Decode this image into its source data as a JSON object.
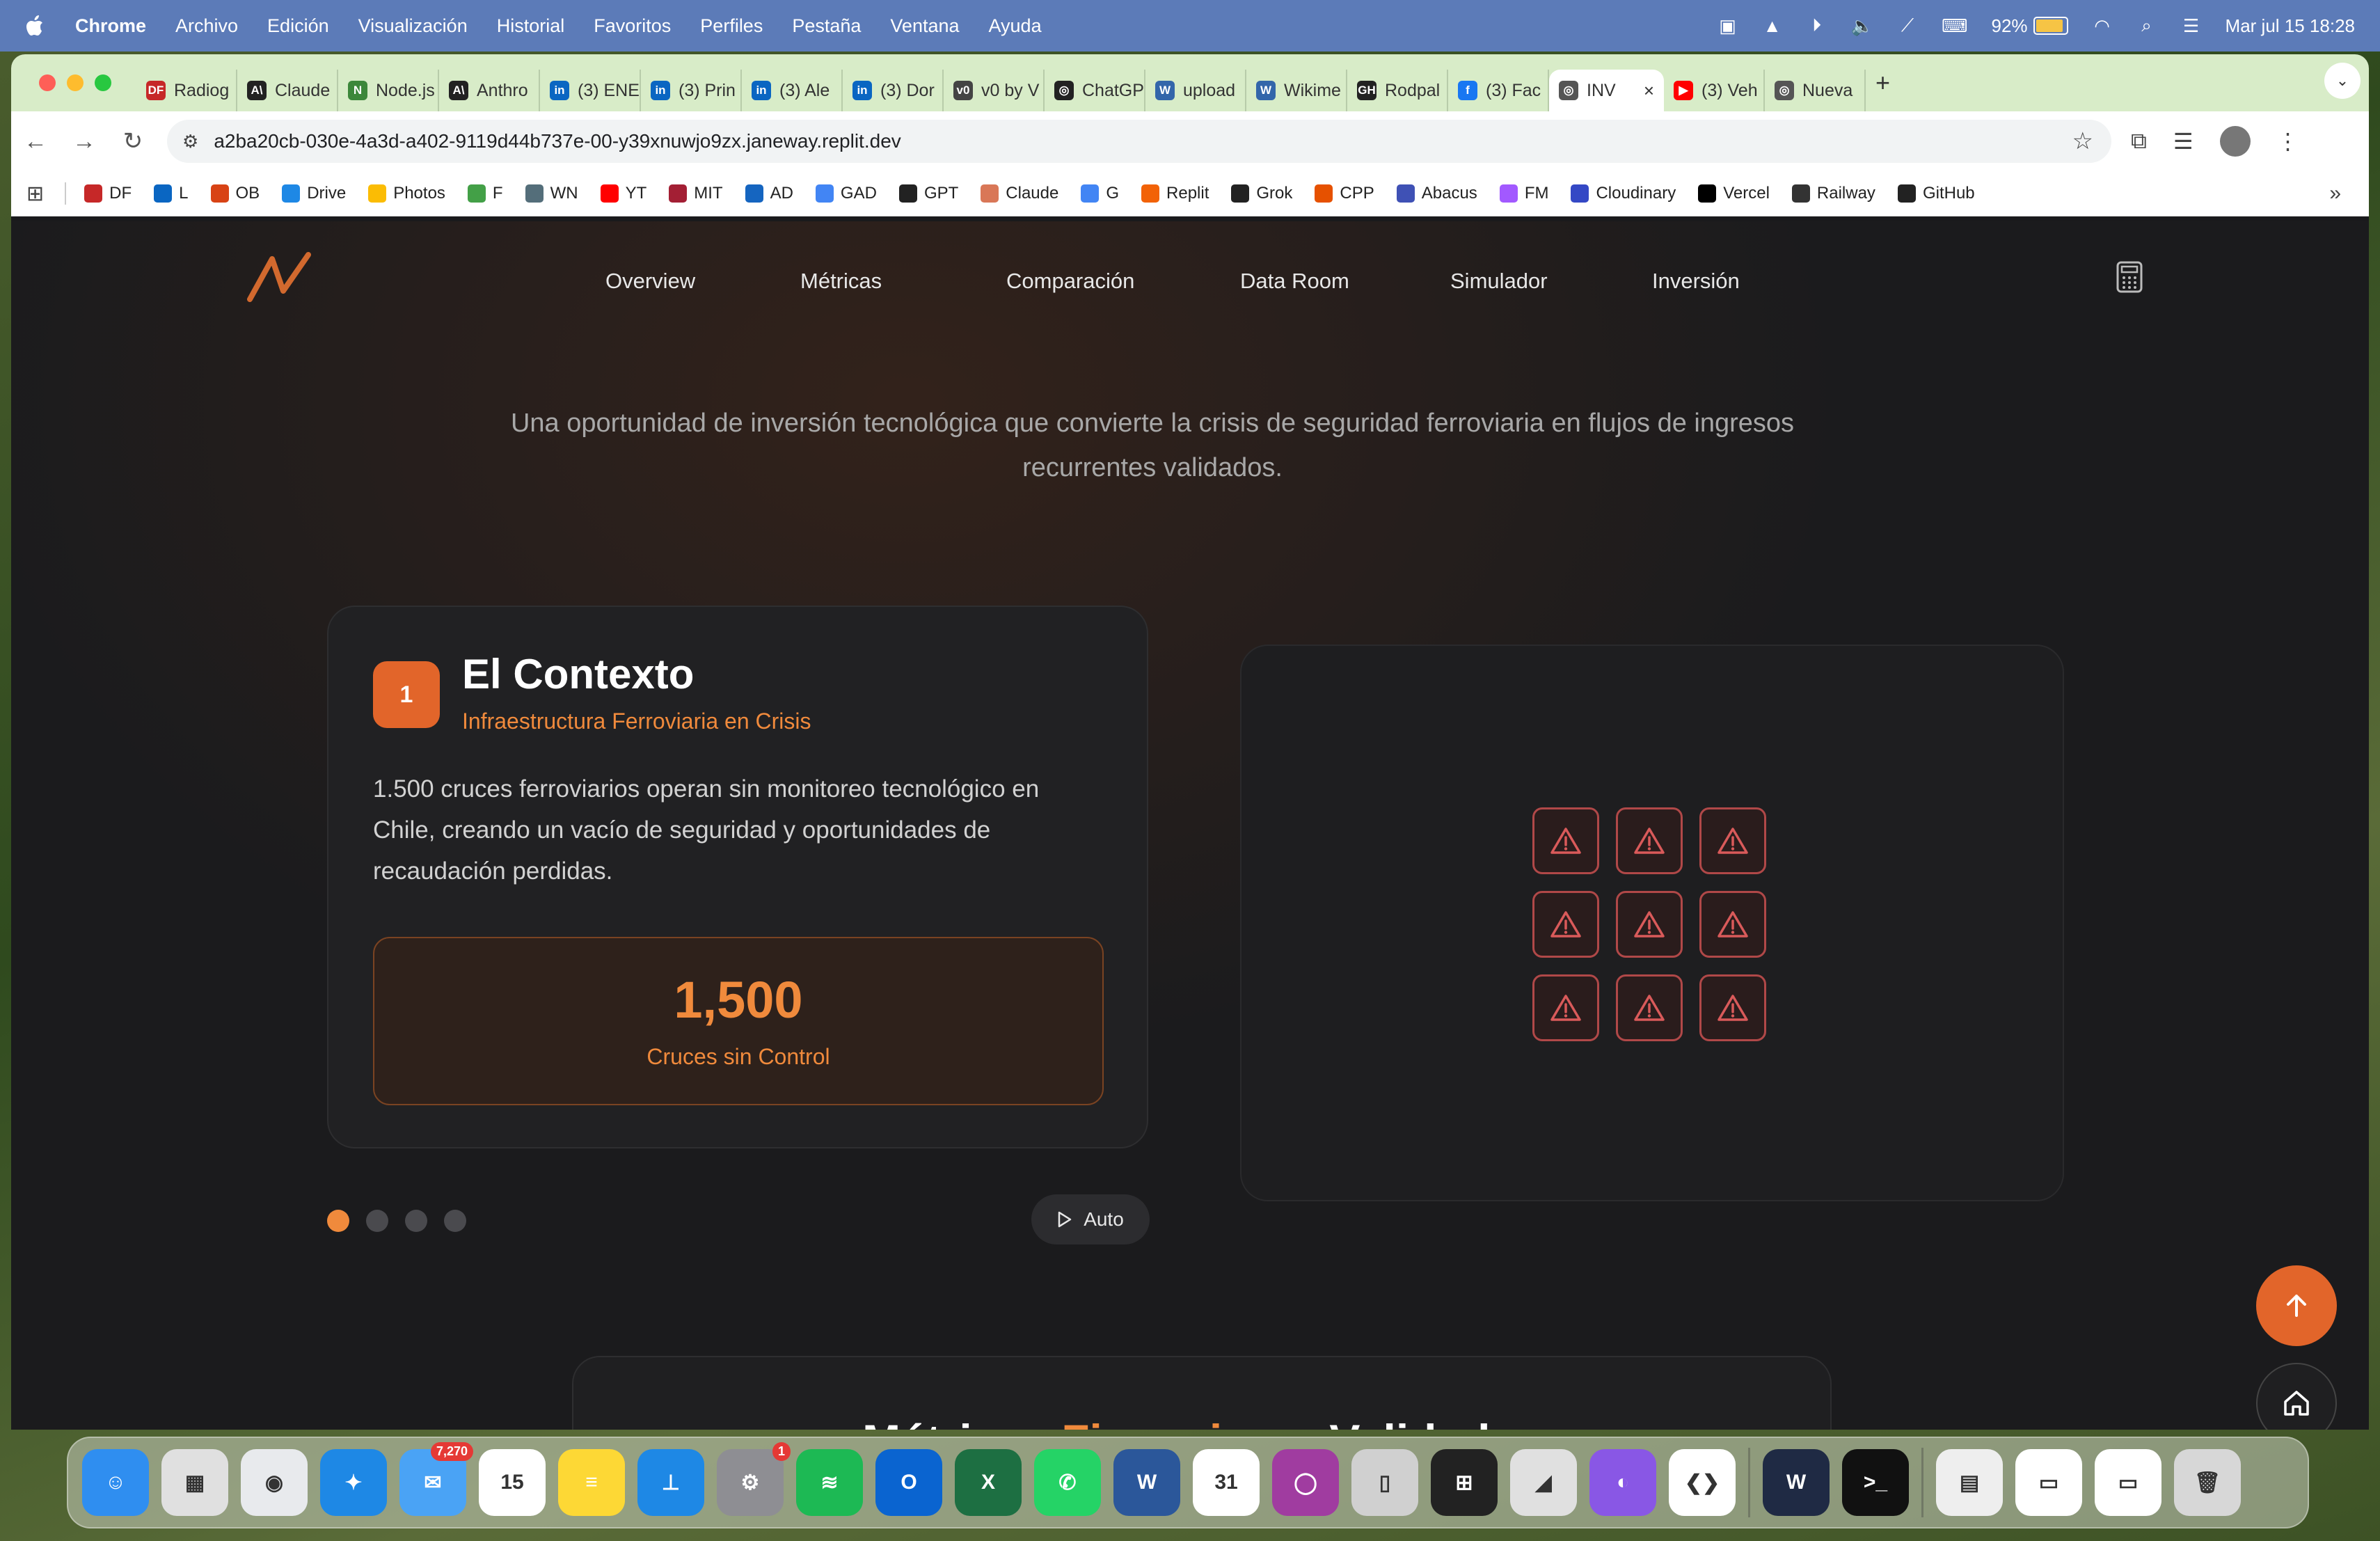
{
  "menubar": {
    "app_name": "Chrome",
    "menus": [
      "Archivo",
      "Edición",
      "Visualización",
      "Historial",
      "Favoritos",
      "Perfiles",
      "Pestaña",
      "Ventana",
      "Ayuda"
    ],
    "battery_percent": "92%",
    "battery_level": 0.92,
    "datetime": "Mar jul 15  18:28"
  },
  "tabs": [
    {
      "title": "Radiog",
      "favicon": "DF",
      "color": "#c62828"
    },
    {
      "title": "Claude",
      "favicon": "A\\",
      "color": "#222222"
    },
    {
      "title": "Node.js",
      "favicon": "N",
      "color": "#3c873a"
    },
    {
      "title": "Anthro",
      "favicon": "A\\",
      "color": "#222222"
    },
    {
      "title": "(3) ENE",
      "favicon": "in",
      "color": "#0a66c2"
    },
    {
      "title": "(3) Prin",
      "favicon": "in",
      "color": "#0a66c2"
    },
    {
      "title": "(3) Ale",
      "favicon": "in",
      "color": "#0a66c2"
    },
    {
      "title": "(3) Dor",
      "favicon": "in",
      "color": "#0a66c2"
    },
    {
      "title": "v0 by V",
      "favicon": "v0",
      "color": "#444444"
    },
    {
      "title": "ChatGP",
      "favicon": "◎",
      "color": "#222222"
    },
    {
      "title": "upload",
      "favicon": "W",
      "color": "#3366aa"
    },
    {
      "title": "Wikime",
      "favicon": "W",
      "color": "#3366aa"
    },
    {
      "title": "Rodpal",
      "favicon": "GH",
      "color": "#222222"
    },
    {
      "title": "(3) Fac",
      "favicon": "f",
      "color": "#1877f2"
    },
    {
      "title": "INV",
      "favicon": "◎",
      "color": "#555555",
      "active": true
    },
    {
      "title": "(3) Veh",
      "favicon": "▶",
      "color": "#ff0000"
    },
    {
      "title": "Nueva",
      "favicon": "◎",
      "color": "#555555"
    }
  ],
  "omnibox": {
    "url": "a2ba20cb-030e-4a3d-a402-9119d44b737e-00-y39xnuwjo9zx.janeway.replit.dev"
  },
  "bookmarks": [
    {
      "label": "DF",
      "color": "#c62828"
    },
    {
      "label": "L",
      "color": "#0a66c2"
    },
    {
      "label": "OB",
      "color": "#d84315"
    },
    {
      "label": "Drive",
      "color": "#1e88e5"
    },
    {
      "label": "Photos",
      "color": "#fbbc04"
    },
    {
      "label": "F",
      "color": "#43a047"
    },
    {
      "label": "WN",
      "color": "#546e7a"
    },
    {
      "label": "YT",
      "color": "#ff0000"
    },
    {
      "label": "MIT",
      "color": "#a31f34"
    },
    {
      "label": "AD",
      "color": "#1565c0"
    },
    {
      "label": "GAD",
      "color": "#4285f4"
    },
    {
      "label": "GPT",
      "color": "#222222"
    },
    {
      "label": "Claude",
      "color": "#d97757"
    },
    {
      "label": "G",
      "color": "#4285f4"
    },
    {
      "label": "Replit",
      "color": "#f26207"
    },
    {
      "label": "Grok",
      "color": "#222222"
    },
    {
      "label": "CPP",
      "color": "#e65100"
    },
    {
      "label": "Abacus",
      "color": "#3f51b5"
    },
    {
      "label": "FM",
      "color": "#a259ff"
    },
    {
      "label": "Cloudinary",
      "color": "#3448c5"
    },
    {
      "label": "Vercel",
      "color": "#000000"
    },
    {
      "label": "Railway",
      "color": "#333333"
    },
    {
      "label": "GitHub",
      "color": "#222222"
    }
  ],
  "site": {
    "nav": [
      "Overview",
      "Métricas",
      "Comparación",
      "Data Room",
      "Simulador",
      "Inversión"
    ],
    "subtitle": "Una oportunidad de inversión tecnológica que convierte la crisis de seguridad ferroviaria en flujos de ingresos recurrentes validados.",
    "accent_color": "#f08a3c",
    "step": {
      "number": "1",
      "title": "El Contexto",
      "subtitle": "Infraestructura Ferroviaria en Crisis",
      "body": "1.500 cruces ferroviarios operan sin monitoreo tecnológico en Chile, creando un vacío de seguridad y oportunidades de recaudación perdidas.",
      "stat_value": "1,500",
      "stat_label": "Cruces sin Control"
    },
    "warning_icons": 9,
    "carousel": {
      "total": 4,
      "active": 1,
      "auto_label": "Auto"
    },
    "metrics_heading": {
      "part1": "Métricas ",
      "accent": "Financieras",
      "part2": " Validadas"
    }
  },
  "dock": {
    "apps": [
      {
        "name": "finder-icon",
        "color": "#2f8ef0",
        "glyph": "☺"
      },
      {
        "name": "launchpad-icon",
        "color": "#e0e0e0",
        "glyph": "▦"
      },
      {
        "name": "chrome-icon",
        "color": "#e8eaed",
        "glyph": "◉"
      },
      {
        "name": "safari-icon",
        "color": "#1e88e5",
        "glyph": "✦"
      },
      {
        "name": "mail-icon",
        "color": "#4aa3f5",
        "glyph": "✉",
        "badge": "7,270"
      },
      {
        "name": "calendar-icon",
        "color": "#ffffff",
        "glyph": "15"
      },
      {
        "name": "notes-icon",
        "color": "#fdd835",
        "glyph": "≡"
      },
      {
        "name": "keynote-icon",
        "color": "#1e88e5",
        "glyph": "⊥"
      },
      {
        "name": "system-settings-icon",
        "color": "#8e8e93",
        "glyph": "⚙",
        "badge": "1"
      },
      {
        "name": "spotify-icon",
        "color": "#1db954",
        "glyph": "≋"
      },
      {
        "name": "outlook-icon",
        "color": "#0a64d0",
        "glyph": "O"
      },
      {
        "name": "excel-icon",
        "color": "#1d6f42",
        "glyph": "X"
      },
      {
        "name": "whatsapp-icon",
        "color": "#25d366",
        "glyph": "✆"
      },
      {
        "name": "word-icon",
        "color": "#2b579a",
        "glyph": "W"
      },
      {
        "name": "fantastical-icon",
        "color": "#ffffff",
        "glyph": "31"
      },
      {
        "name": "screen-recorder-icon",
        "color": "#a03ca0",
        "glyph": "◯"
      },
      {
        "name": "iphone-mirroring-icon",
        "color": "#d0d0d0",
        "glyph": "▯"
      },
      {
        "name": "tableplus-icon",
        "color": "#222222",
        "glyph": "⊞"
      },
      {
        "name": "cursor-icon",
        "color": "#e0e0e0",
        "glyph": "◢"
      },
      {
        "name": "github-desktop-icon",
        "color": "#8957e5",
        "glyph": "◐"
      },
      {
        "name": "vscode-icon",
        "color": "#ffffff",
        "glyph": "❮❯"
      },
      {
        "name": "windsurf-icon",
        "color": "#1f2a44",
        "glyph": "W"
      },
      {
        "name": "terminal-icon",
        "color": "#111111",
        "glyph": ">_"
      },
      {
        "name": "document-stack-icon",
        "color": "#eeeeee",
        "glyph": "▤"
      },
      {
        "name": "mail-window-icon",
        "color": "#ffffff",
        "glyph": "▭"
      },
      {
        "name": "mail-window-2-icon",
        "color": "#ffffff",
        "glyph": "▭"
      },
      {
        "name": "trash-icon",
        "color": "#d7d7d7",
        "glyph": "🗑"
      }
    ]
  }
}
